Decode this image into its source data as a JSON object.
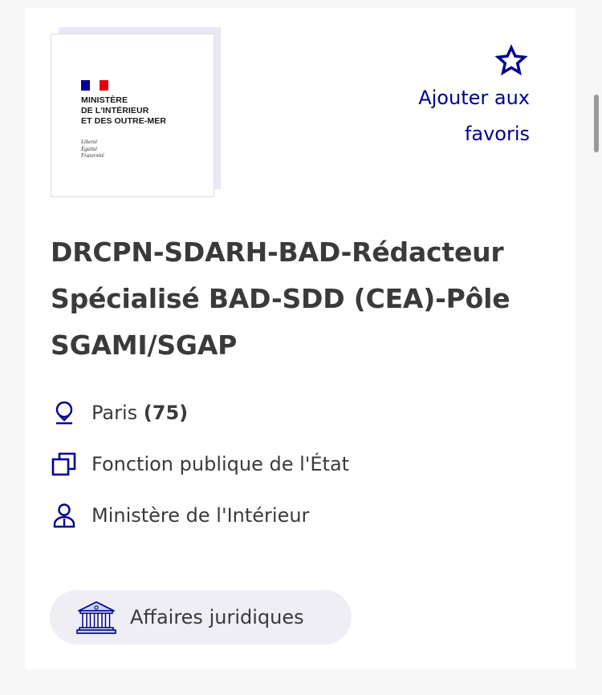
{
  "logo": {
    "name_lines": [
      "MINISTÈRE",
      "DE L'INTÉRIEUR",
      "ET DES OUTRE-MER"
    ],
    "motto_lines": [
      "Liberté",
      "Égalité",
      "Fraternité"
    ],
    "flag_colors": [
      "#000091",
      "#ffffff",
      "#e1000f"
    ]
  },
  "favorite": {
    "icon": "star-icon",
    "label_line1": "Ajouter aux",
    "label_line2": "favoris"
  },
  "job": {
    "title_lines": [
      "DRCPN-SDARH-BAD-Rédacteur",
      "Spécialisé BAD-SDD (CEA)-Pôle",
      "SGAMI/SGAP"
    ],
    "location": {
      "icon": "location-pin-icon",
      "city": "Paris",
      "code": "(75)"
    },
    "sector": {
      "icon": "copy-stack-icon",
      "text": "Fonction publique de l'État"
    },
    "employer": {
      "icon": "user-icon",
      "text": "Ministère de l'Intérieur"
    },
    "tag": {
      "icon": "institution-building-icon",
      "text": "Affaires juridiques"
    }
  },
  "colors": {
    "accent": "#000091",
    "text": "#3a3a3a",
    "tag_bg": "#eeeef4",
    "page_bg": "#f6f6f6"
  }
}
